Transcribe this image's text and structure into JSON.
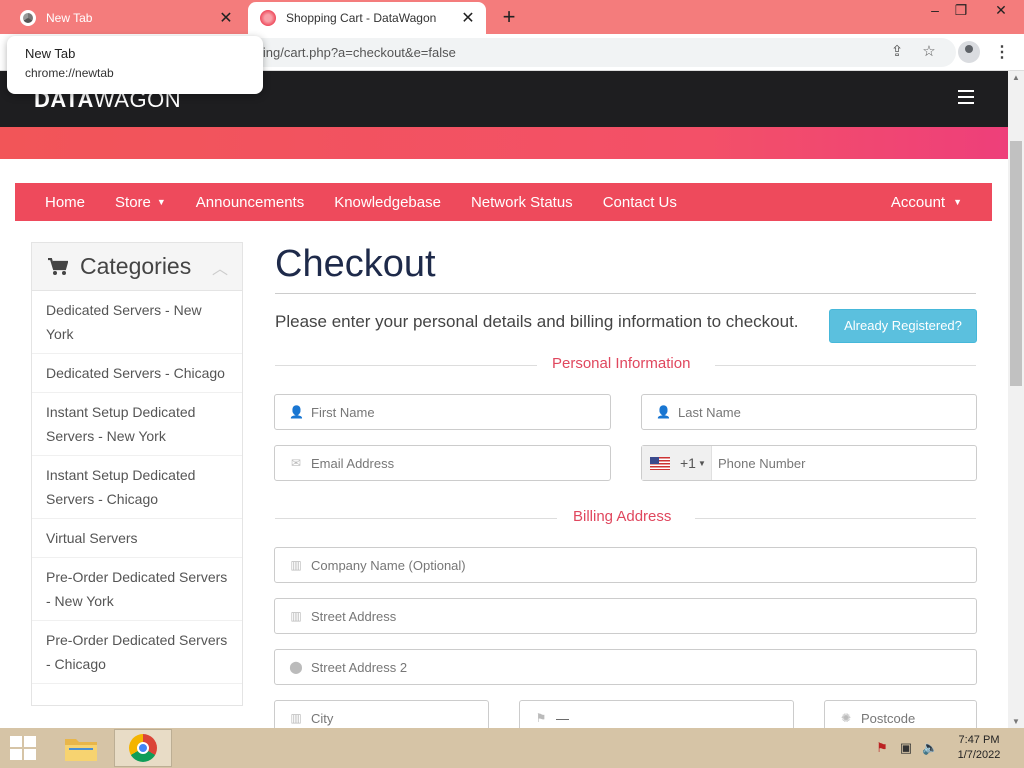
{
  "browser": {
    "tabs": [
      {
        "title": "New Tab",
        "close": "✕"
      },
      {
        "title": "Shopping Cart - DataWagon",
        "close": "✕"
      }
    ],
    "new_tab": "+",
    "window_controls": {
      "minimize": "–",
      "restore": "❐",
      "close": "✕"
    },
    "url": "ling/cart.php?a=checkout&e=false",
    "tooltip": {
      "title": "New Tab",
      "url": "chrome://newtab"
    }
  },
  "header": {
    "logo_bold": "DATA",
    "logo_light": "WAGON"
  },
  "nav": {
    "items": [
      "Home",
      "Store",
      "Announcements",
      "Knowledgebase",
      "Network Status",
      "Contact Us"
    ],
    "account": "Account",
    "caret": "▼"
  },
  "sidebar": {
    "title": "Categories",
    "chevron": "︿",
    "items": [
      "Dedicated Servers - New York",
      "Dedicated Servers - Chicago",
      "Instant Setup Dedicated Servers - New York",
      "Instant Setup Dedicated Servers - Chicago",
      "Virtual Servers",
      "Pre-Order Dedicated Servers - New York",
      "Pre-Order Dedicated Servers - Chicago"
    ]
  },
  "main": {
    "title": "Checkout",
    "intro": "Please enter your personal details and billing information to checkout.",
    "already_registered": "Already Registered?",
    "personal_section": "Personal Information",
    "billing_section": "Billing Address",
    "fields": {
      "first_name": "First Name",
      "last_name": "Last Name",
      "email": "Email Address",
      "phone": "Phone Number",
      "dial_code": "+1",
      "company": "Company Name (Optional)",
      "street": "Street Address",
      "street2": "Street Address 2",
      "city": "City",
      "state": "—",
      "postcode": "Postcode"
    }
  },
  "taskbar": {
    "time": "7:47 PM",
    "date": "1/7/2022"
  }
}
